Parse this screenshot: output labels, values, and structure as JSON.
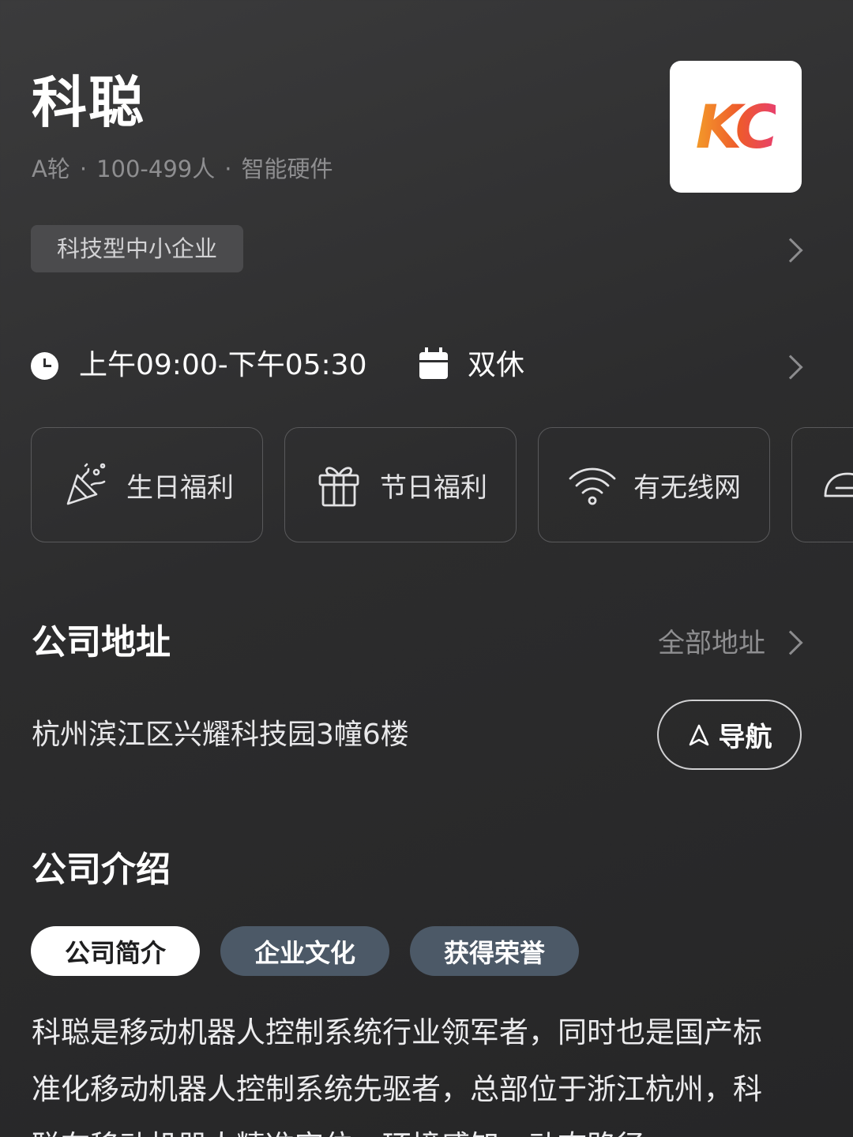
{
  "company": {
    "name": "科聪",
    "funding": "A轮",
    "size": "100-499人",
    "industry": "智能硬件",
    "meta_separator": "·",
    "logo_text": "KC",
    "tag": "科技型中小企业"
  },
  "hours": {
    "time": "上午09:00-下午05:30",
    "rest": "双休"
  },
  "benefits": [
    {
      "label": "生日福利",
      "icon": "party-popper-icon"
    },
    {
      "label": "节日福利",
      "icon": "gift-icon"
    },
    {
      "label": "有无线网",
      "icon": "wifi-icon"
    },
    {
      "label": "",
      "icon": "helmet-icon"
    }
  ],
  "address": {
    "title": "公司地址",
    "all_link": "全部地址",
    "text": "杭州滨江区兴耀科技园3幢6楼",
    "nav_label": "导航"
  },
  "intro": {
    "title": "公司介绍",
    "tabs": [
      "公司简介",
      "企业文化",
      "获得荣誉"
    ],
    "active_tab": 0,
    "text": "科聪是移动机器人控制系统行业领军者，同时也是国产标准化移动机器人控制系统先驱者，总部位于浙江杭州，科聪在移动机器人精准定位、环境感知、动态路径"
  },
  "colors": {
    "background": "#2c2c2d",
    "tab_inactive": "#4c5967",
    "logo_gradient": [
      "#f39a2a",
      "#ee5a2c",
      "#e8416b"
    ]
  }
}
